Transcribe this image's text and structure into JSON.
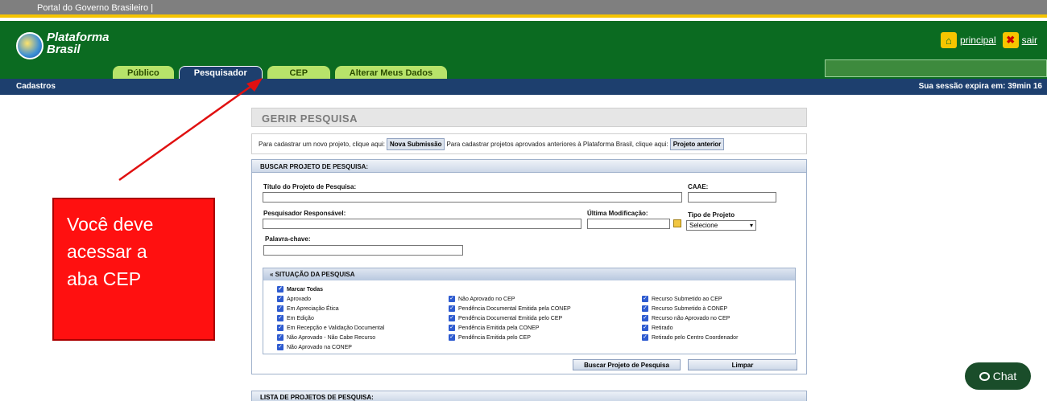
{
  "gov_bar": {
    "text": "Portal do Governo Brasileiro  |"
  },
  "header": {
    "logo_text_1": "Plataforma",
    "logo_text_2": "Brasil",
    "link_principal": "principal",
    "link_sair": "sair"
  },
  "tabs": [
    {
      "label": "Público"
    },
    {
      "label": "Pesquisador"
    },
    {
      "label": "CEP"
    },
    {
      "label": "Alterar Meus Dados"
    }
  ],
  "navbar": {
    "left": "Cadastros",
    "right": "Sua sessão expira em: 39min 16"
  },
  "page": {
    "title": "GERIR PESQUISA",
    "submit_text_1": "Para cadastrar um novo projeto, clique aqui:",
    "btn_nova": "Nova Submissão",
    "submit_text_2": "Para cadastrar projetos aprovados anteriores à Plataforma Brasil, clique aqui:",
    "btn_anterior": "Projeto anterior"
  },
  "search": {
    "header": "BUSCAR PROJETO DE PESQUISA:",
    "titulo_label": "Título do Projeto de Pesquisa:",
    "caae_label": "CAAE:",
    "pesquisador_label": "Pesquisador Responsável:",
    "ultima_label": "Última Modificação:",
    "tipo_label": "Tipo de Projeto",
    "tipo_value": "Selecione",
    "palavra_label": "Palavra-chave:"
  },
  "situacao": {
    "header": "SITUAÇÃO DA PESQUISA",
    "marcar": "Marcar Todas",
    "col1": [
      "Aprovado",
      "Em Apreciação Ética",
      "Em Edição",
      "Em Recepção e Validação Documental",
      "Não Aprovado - Não Cabe Recurso",
      "Não Aprovado na CONEP"
    ],
    "col2": [
      "Não Aprovado no CEP",
      "Pendência Documental Emitida pela CONEP",
      "Pendência Documental Emitida pelo CEP",
      "Pendência Emitida pela CONEP",
      "Pendência Emitida pelo CEP"
    ],
    "col3": [
      "Recurso Submetido ao CEP",
      "Recurso Submetido à CONEP",
      "Recurso não Aprovado no CEP",
      "Retirado",
      "Retirado pelo Centro Coordenador"
    ]
  },
  "actions": {
    "buscar": "Buscar Projeto de Pesquisa",
    "limpar": "Limpar"
  },
  "list": {
    "header": "LISTA DE PROJETOS DE PESQUISA:"
  },
  "callout": {
    "line1": "Você deve",
    "line2": "acessar a",
    "line3": "aba CEP"
  },
  "chat": {
    "label": "Chat"
  },
  "colors": {
    "header_green": "#0b6b21",
    "nav_blue": "#1d3f6e",
    "callout_red": "#ff1010",
    "tab_green": "#b7e36a"
  }
}
